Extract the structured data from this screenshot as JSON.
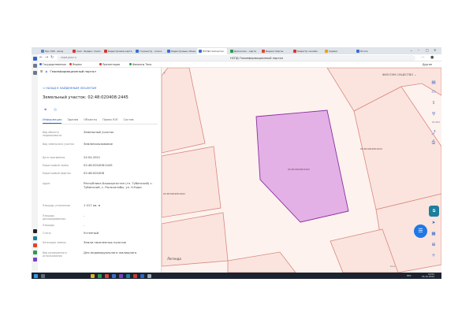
{
  "browser": {
    "tabs": [
      {
        "label": "Про 500 - вход",
        "color": "#5e86c9"
      },
      {
        "label": "mail - Яндекс поиск",
        "color": "#d4382b"
      },
      {
        "label": "Кадастровая карта",
        "color": "#d4382b"
      },
      {
        "label": "Госреестр - поиск",
        "color": "#3a6ed1"
      },
      {
        "label": "Кадастровые объекты",
        "color": "#3a6ed1"
      },
      {
        "label": "НСПД Геопортал",
        "color": "#3a6ed1"
      },
      {
        "label": "Домоклик - карта",
        "color": "#2b9a4b"
      },
      {
        "label": "Яндекс Карты",
        "color": "#e0422d"
      },
      {
        "label": "Кадастр онлайн",
        "color": "#d4382b"
      },
      {
        "label": "Сервис",
        "color": "#e8a21b"
      },
      {
        "label": "Почта",
        "color": "#3a6ed1"
      }
    ],
    "active_tab_index": 5,
    "url": "nspd.gov.ru",
    "page_title": "НСПД Геоинформационный портал",
    "bookmarks": [
      {
        "label": "Государственные",
        "color": "#3a6ed1"
      },
      {
        "label": "Яндекс",
        "color": "#e0422d"
      },
      {
        "label": "Презентация",
        "color": "#d4382b"
      },
      {
        "label": "Финансы Тоня",
        "color": "#2b9a4b"
      }
    ],
    "user_label": "Другие"
  },
  "panel": {
    "header": "Геоинформационный портал",
    "back_link": "< НАЗАД К НАЙДЕННЫМ ОБЪЕКТАМ",
    "title": "Земельный участок: 02:48:020408:2445",
    "tabs": [
      "Информация",
      "Здания",
      "Объекты",
      "Права ЮЛ",
      "Состав"
    ],
    "active_tab": 0,
    "rows": [
      {
        "label": "Вид объекта недвижимости",
        "value": "Земельный участок"
      },
      {
        "label": "Вид земельного участка",
        "value": "Землепользование"
      },
      {
        "label": "Дата присвоения",
        "value": "24.04.2021"
      },
      {
        "label": "Кадастровый номер",
        "value": "02:48:020408:2445"
      },
      {
        "label": "Кадастровый квартал",
        "value": "02:48:020408"
      },
      {
        "label": "Адрес",
        "value": "Республика Башкортостан (гп. Тубинский) с. Тубинский, с. Рыльчатобы, ул. Н.Коро"
      },
      {
        "label": "Площадь уточненная",
        "value": "1 017 кв. м"
      },
      {
        "label": "Площадь декларированная",
        "value": "-"
      },
      {
        "label": "Площадь",
        "value": "-"
      },
      {
        "label": "Статус",
        "value": "Учтенный"
      },
      {
        "label": "Категория земель",
        "value": "Земли населенных пунктов"
      },
      {
        "label": "Вид разрешенного использования",
        "value": "Для индивидуального жилищного"
      }
    ]
  },
  "map": {
    "layer_select": "ФИЗ ЕЭМ СУЩЕСТВО ⌄",
    "legend": "Легенда",
    "parcel_labels": {
      "selected": "02:48:020408:2445",
      "right": "02:48:020408:2444",
      "left": "02:48:020408:2402"
    },
    "coord_hint": "02:48:0",
    "scale_text": "10 м",
    "chat_icon": "chat-icon",
    "right_tools": [
      "layers-icon",
      "fullscreen-icon",
      "share-icon",
      "print-icon",
      "navigation-icon",
      "measure-icon",
      "grid-icon",
      "plus-icon"
    ]
  },
  "taskbar": {
    "lang": "РУС",
    "time": "12:01",
    "date": "24.10.2024"
  },
  "colors": {
    "selected_parcel_fill": "#e3b1e6",
    "selected_parcel_stroke": "#8b2fa0",
    "parcel_stroke": "#d98880",
    "map_bg": "#fdf2ee",
    "accent": "#2f63c6"
  }
}
